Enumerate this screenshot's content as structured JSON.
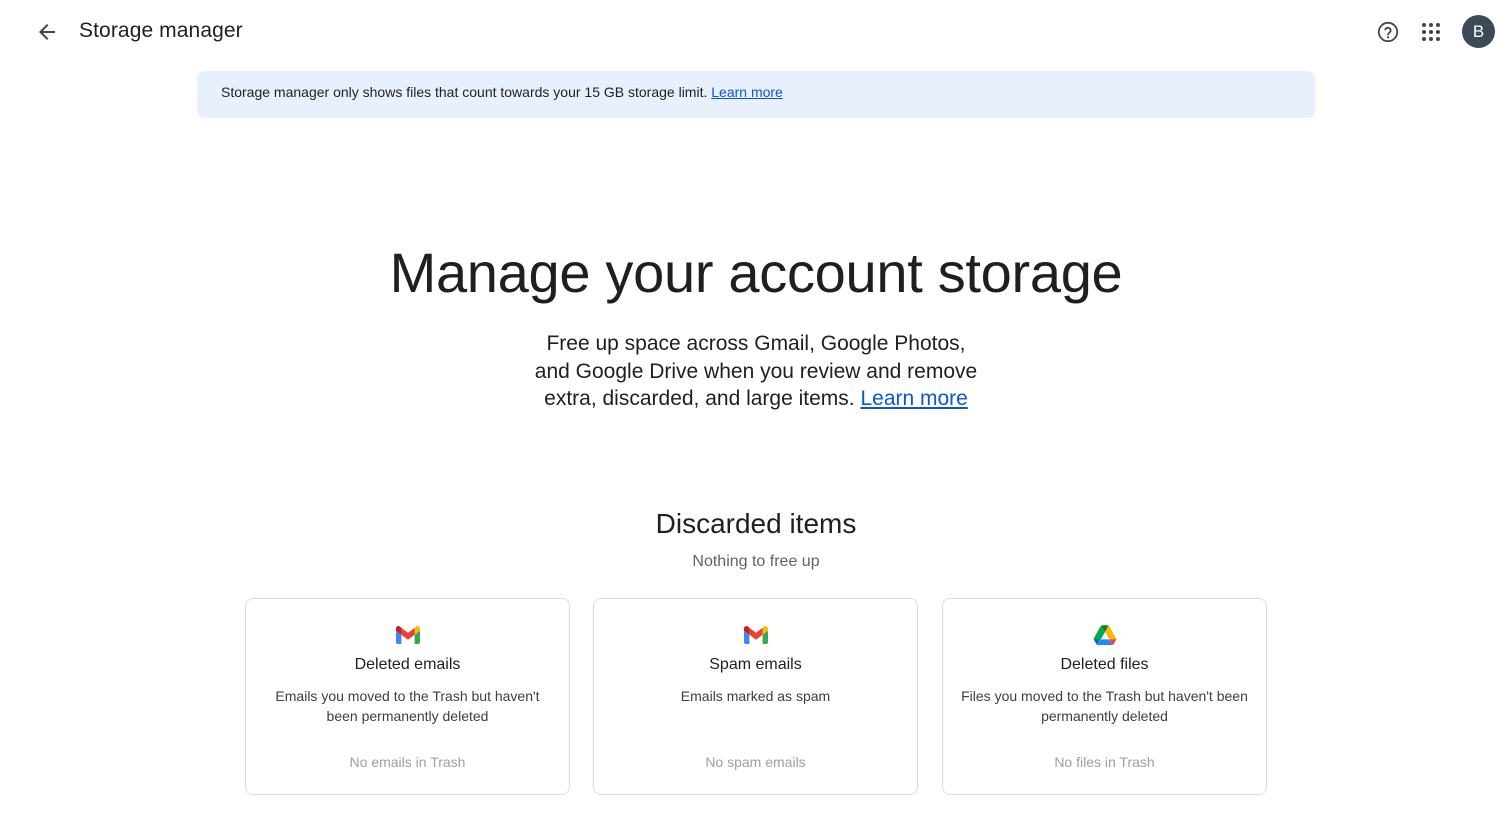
{
  "header": {
    "title": "Storage manager",
    "avatar_letter": "B",
    "avatar_color": "#3c4a57",
    "icons": [
      "back-arrow-icon",
      "help-icon",
      "apps-grid-icon"
    ]
  },
  "notice": {
    "text": "Storage manager only shows files that count towards your 15 GB storage limit. ",
    "link": "Learn more",
    "background": "#e8f0fe"
  },
  "hero": {
    "title": "Manage your account storage",
    "line1": "Free up space across Gmail, Google Photos,",
    "line2": "and Google Drive when you review and remove",
    "line3": "extra, discarded, and large items. ",
    "link": "Learn more"
  },
  "discarded": {
    "title": "Discarded items",
    "subtitle": "Nothing to free up",
    "cards": [
      {
        "icon": "gmail-icon",
        "title": "Deleted emails",
        "description": "Emails you moved to the Trash but haven't been permanently deleted",
        "status": "No emails in Trash"
      },
      {
        "icon": "gmail-icon",
        "title": "Spam emails",
        "description": "Emails marked as spam",
        "status": "No spam emails"
      },
      {
        "icon": "google-drive-icon",
        "title": "Deleted files",
        "description": "Files you moved to the Trash but haven't been permanently deleted",
        "status": "No files in Trash"
      }
    ]
  },
  "colors": {
    "link": "#0b57d0",
    "muted": "#9aa0a6",
    "card_border": "#dadce0"
  }
}
